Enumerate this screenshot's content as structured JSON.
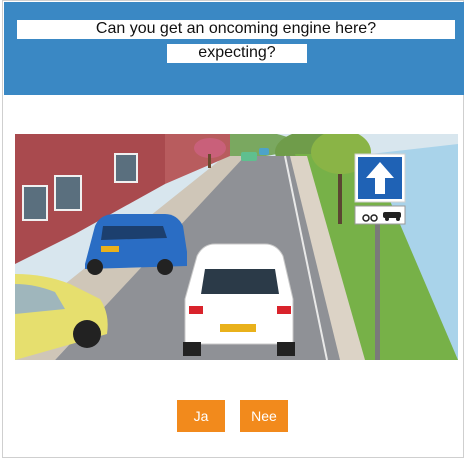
{
  "question": {
    "line1": "Can you get an oncoming engine here?",
    "line2": "expecting?"
  },
  "answers": {
    "yes_label": "Ja",
    "no_label": "Nee"
  },
  "colors": {
    "header": "#3a88c4",
    "button": "#f28a1c",
    "sign_blue": "#1f62b5"
  },
  "scene": {
    "sign_icon": "arrow-up-icon",
    "sub_sign_icons": [
      "motorcycle-icon",
      "car-icon"
    ]
  }
}
